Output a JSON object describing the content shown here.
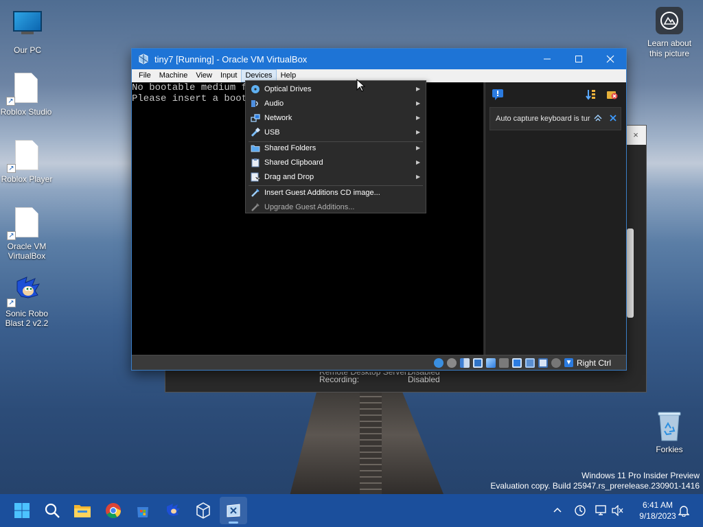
{
  "desktop": {
    "icons": [
      {
        "label": "Our PC",
        "icon": "computer-icon"
      },
      {
        "label": "Roblox Studio",
        "icon": "file-icon"
      },
      {
        "label": "Roblox Player",
        "icon": "file-icon"
      },
      {
        "label": "Oracle VM VirtualBox",
        "icon": "file-icon"
      },
      {
        "label": "Sonic Robo Blast 2 v2.2",
        "icon": "sonic-icon"
      },
      {
        "label": "Forkies",
        "icon": "recycle-bin-icon"
      }
    ],
    "learn_label": "Learn about this picture",
    "watermark": {
      "line1": "Windows 11 Pro Insider Preview",
      "line2": "Evaluation copy. Build 25947.rs_prerelease.230901-1416"
    }
  },
  "background_window": {
    "row1_label": "Remote Desktop Server:",
    "row1_value": "Disabled",
    "row2_label": "Recording:",
    "row2_value": "Disabled",
    "close_glyph": "×"
  },
  "vbox": {
    "title": "tiny7 [Running] - Oracle VM VirtualBox",
    "menu": [
      "File",
      "Machine",
      "View",
      "Input",
      "Devices",
      "Help"
    ],
    "active_menu": "Devices",
    "screen_line1": "No bootable medium found!",
    "screen_line2": "Please insert a bootable medium and reboot.",
    "notice": "Auto capture keyboard is turned on",
    "host_key": "Right Ctrl",
    "accent_color": "#1e74d6"
  },
  "devices_menu": {
    "items": [
      {
        "label": "Optical Drives",
        "icon": "optical-disc-icon",
        "submenu": true
      },
      {
        "label": "Audio",
        "icon": "audio-icon",
        "submenu": true
      },
      {
        "label": "Network",
        "icon": "network-icon",
        "submenu": true
      },
      {
        "label": "USB",
        "icon": "usb-icon",
        "submenu": true
      },
      {
        "label": "Shared Folders",
        "icon": "shared-folder-icon",
        "submenu": true
      },
      {
        "label": "Shared Clipboard",
        "icon": "clipboard-icon",
        "submenu": true
      },
      {
        "label": "Drag and Drop",
        "icon": "drag-drop-icon",
        "submenu": true
      },
      {
        "label": "Insert Guest Additions CD image...",
        "icon": "guest-additions-icon",
        "submenu": false
      },
      {
        "label": "Upgrade Guest Additions...",
        "icon": "guest-additions-icon",
        "submenu": false,
        "disabled": true
      }
    ]
  },
  "taskbar": {
    "apps": [
      "start-icon",
      "search-icon",
      "file-explorer-icon",
      "chrome-icon",
      "store-icon",
      "sonic-icon",
      "virtualbox-icon",
      "virtualbox-vm-icon"
    ],
    "time": "6:41 AM",
    "date": "9/18/2023"
  }
}
